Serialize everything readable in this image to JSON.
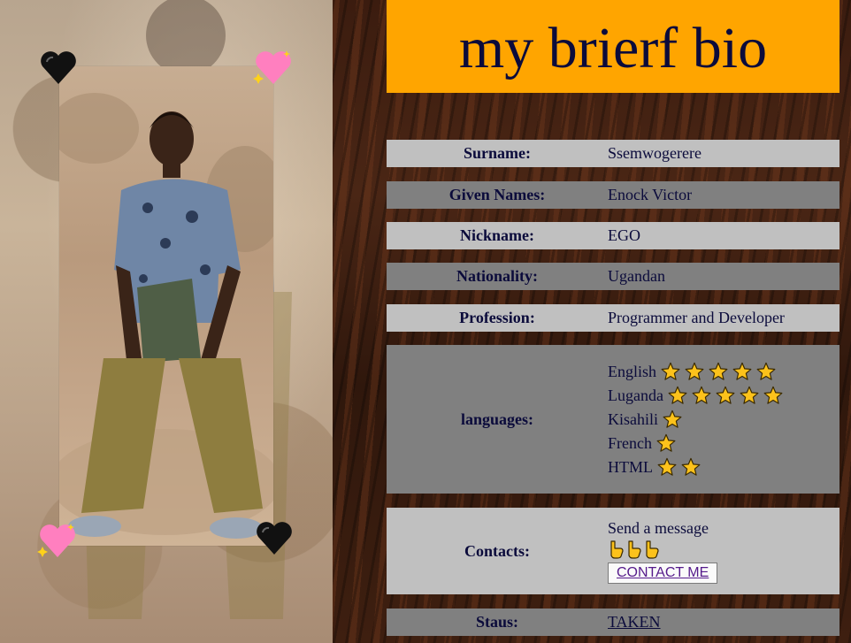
{
  "title": "my brierf bio",
  "rows": {
    "surname": {
      "label": "Surname:",
      "value": "Ssemwogerere"
    },
    "given": {
      "label": "Given Names:",
      "value": "Enock Victor"
    },
    "nickname": {
      "label": "Nickname:",
      "value": "EGO"
    },
    "nationality": {
      "label": "Nationality:",
      "value": "Ugandan"
    },
    "profession": {
      "label": "Profession:",
      "value": "Programmer and Developer"
    },
    "languages": {
      "label": "languages:",
      "items": [
        {
          "name": "English",
          "stars": 5
        },
        {
          "name": "Luganda",
          "stars": 5
        },
        {
          "name": "Kisahili",
          "stars": 1
        },
        {
          "name": "French",
          "stars": 1
        },
        {
          "name": "HTML",
          "stars": 2
        }
      ]
    },
    "contacts": {
      "label": "Contacts:",
      "text": "Send a message",
      "pointers": 3,
      "button": "CONTACT ME"
    },
    "status": {
      "label": "Staus:",
      "value": "TAKEN"
    }
  },
  "icons": {
    "heart_black": "black-heart-icon",
    "heart_sparkle": "sparkling-heart-icon",
    "star": "star-icon",
    "pointer": "pointing-down-hand-icon"
  },
  "colors": {
    "title_bg": "#ffa500",
    "row_light": "#c0c0c0",
    "row_dark": "#808080",
    "text": "#0b0b3b"
  }
}
